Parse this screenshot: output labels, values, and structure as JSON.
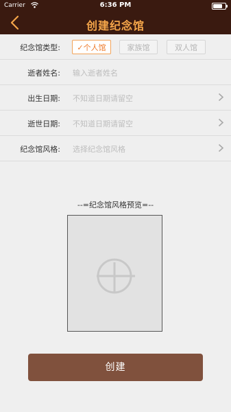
{
  "status_bar": {
    "carrier": "Carrier",
    "time": "6:36 PM",
    "battery_level": 0.85
  },
  "nav": {
    "title": "创建纪念馆",
    "back_icon": "chevron-left-icon"
  },
  "form": {
    "type": {
      "label": "纪念馆类型:",
      "options": [
        {
          "label": "个人馆",
          "selected": true
        },
        {
          "label": "家族馆",
          "selected": false
        },
        {
          "label": "双人馆",
          "selected": false
        }
      ]
    },
    "name": {
      "label": "逝者姓名:",
      "placeholder": "输入逝者姓名"
    },
    "birth_date": {
      "label": "出生日期:",
      "placeholder": "不知道日期请留空"
    },
    "death_date": {
      "label": "逝世日期:",
      "placeholder": "不知道日期请留空"
    },
    "style": {
      "label": "纪念馆风格:",
      "placeholder": "选择纪念馆风格"
    }
  },
  "preview": {
    "title": "--=纪念馆风格预览=--",
    "icon": "add-image-icon"
  },
  "create_button": {
    "label": "创建"
  },
  "colors": {
    "nav_bg": "#3a1a10",
    "accent": "#f5a64a",
    "button": "#80513d",
    "selected_text": "#ee7a2a"
  }
}
